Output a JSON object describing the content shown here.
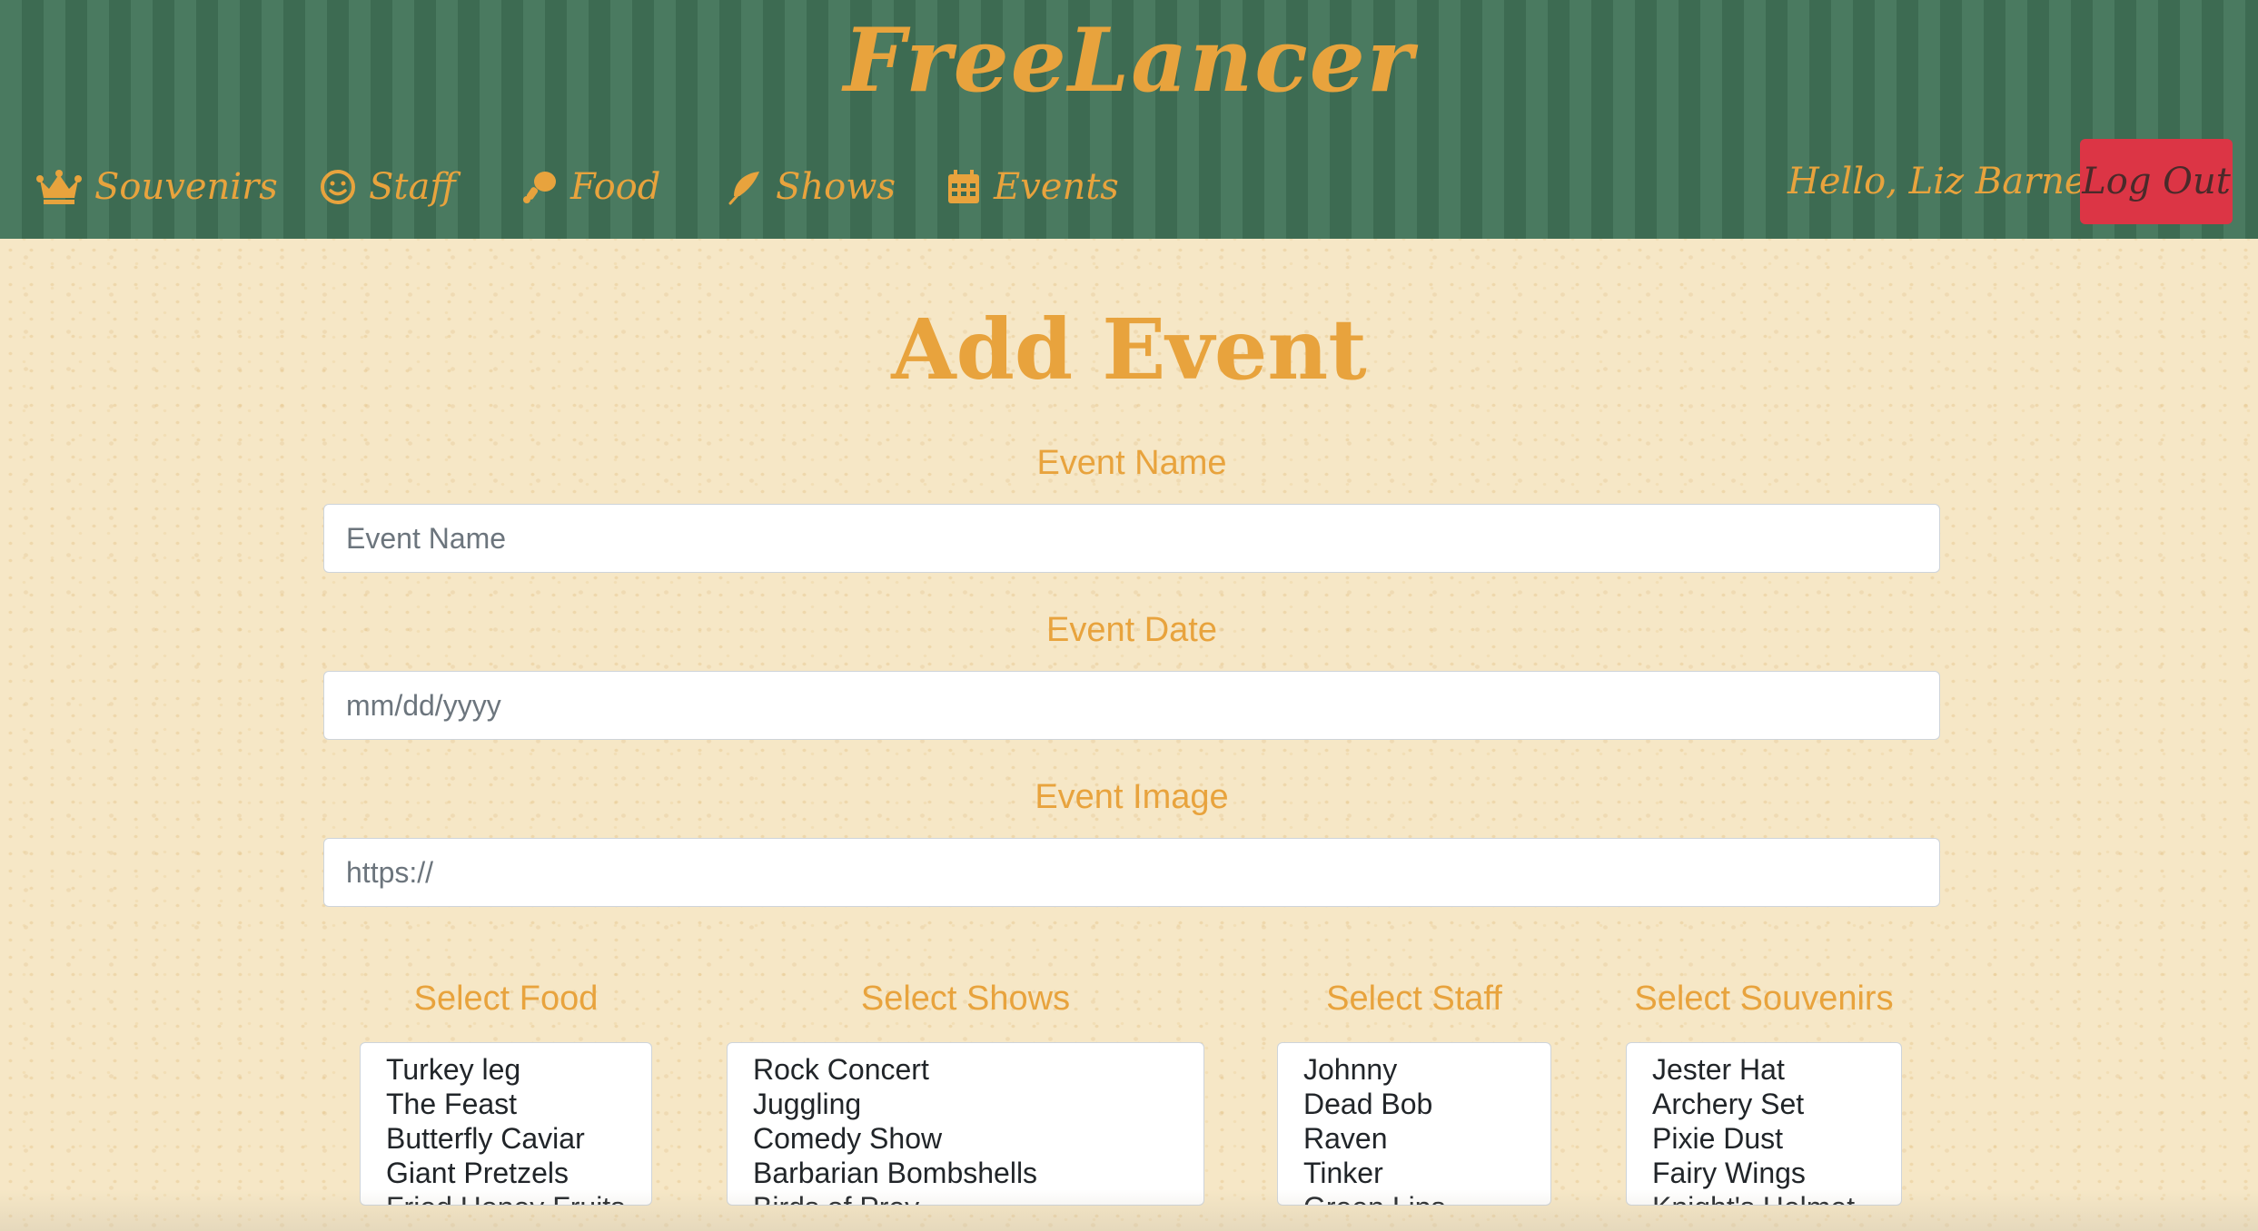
{
  "app": {
    "brand": "FreeLancer",
    "greeting": "Hello, Liz Barnes!",
    "logout_label": "Log Out",
    "accent_color": "#e8a33d",
    "header_color": "#4a7a60",
    "logout_color": "#dc3545"
  },
  "nav": {
    "items": [
      {
        "label": "Souvenirs",
        "icon": "crown-icon"
      },
      {
        "label": "Staff",
        "icon": "smile-icon"
      },
      {
        "label": "Food",
        "icon": "drumstick-icon"
      },
      {
        "label": "Shows",
        "icon": "feather-icon"
      },
      {
        "label": "Events",
        "icon": "calendar-icon"
      }
    ]
  },
  "form": {
    "title": "Add Event",
    "event_name": {
      "label": "Event Name",
      "placeholder": "Event Name",
      "value": ""
    },
    "event_date": {
      "label": "Event Date",
      "placeholder": "mm/dd/yyyy",
      "value": ""
    },
    "event_image": {
      "label": "Event Image",
      "placeholder": "https://",
      "value": ""
    }
  },
  "selects": {
    "food": {
      "label": "Select Food",
      "options": [
        "Turkey leg",
        "The Feast",
        "Butterfly Caviar",
        "Giant Pretzels",
        "Fried Honey Fruits"
      ]
    },
    "shows": {
      "label": "Select Shows",
      "options": [
        "Rock Concert",
        "Juggling",
        "Comedy Show",
        "Barbarian Bombshells",
        "Birds of Prey"
      ]
    },
    "staff": {
      "label": "Select Staff",
      "options": [
        "Johnny",
        "Dead Bob",
        "Raven",
        "Tinker",
        "Green Lips"
      ]
    },
    "souvenirs": {
      "label": "Select Souvenirs",
      "options": [
        "Jester Hat",
        "Archery Set",
        "Pixie Dust",
        "Fairy Wings",
        "Knight's Helmet"
      ]
    }
  }
}
